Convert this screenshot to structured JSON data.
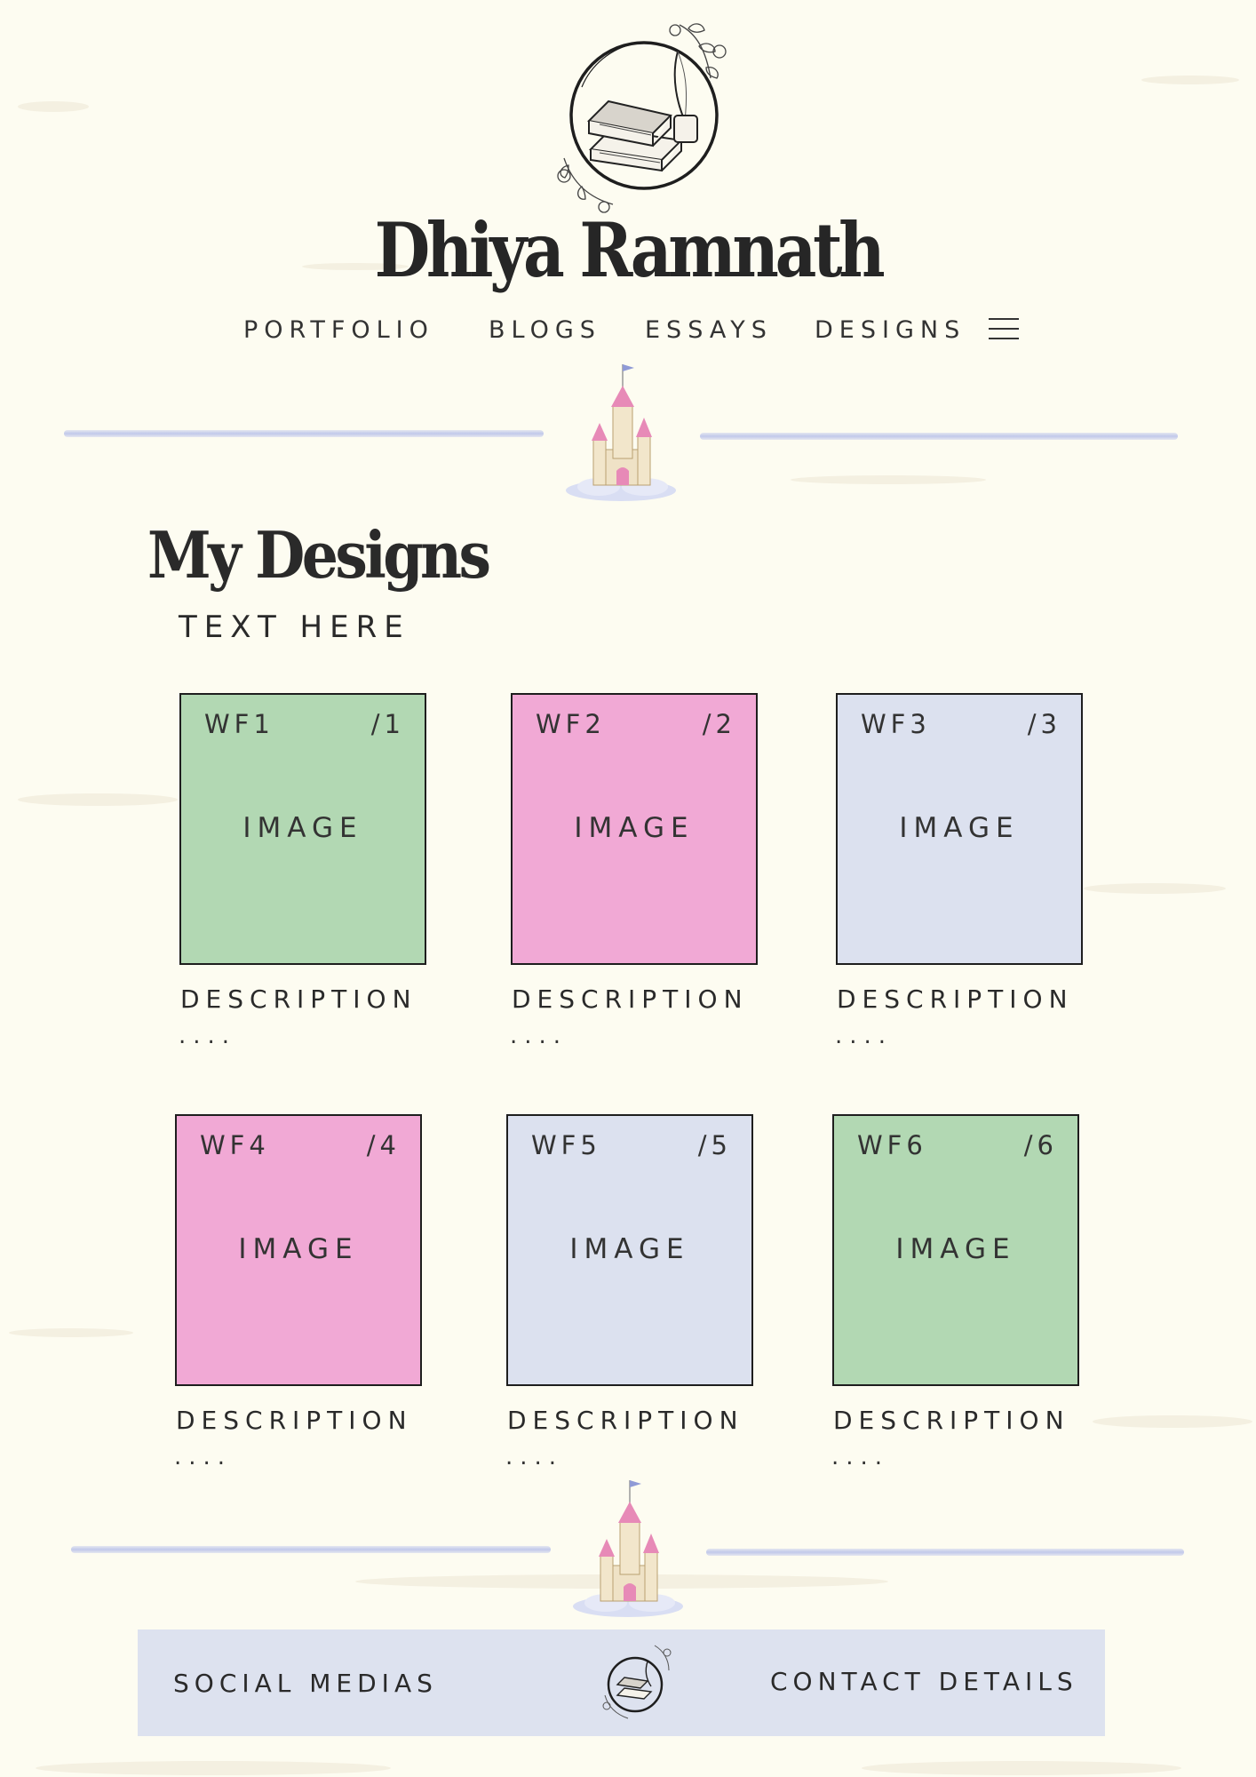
{
  "header": {
    "site_title": "Dhiya Ramnath",
    "logo_icon": "books-quill-ink-wreath-icon"
  },
  "nav": {
    "items": [
      {
        "label": "PORTFOLIO"
      },
      {
        "label": "BLOGS"
      },
      {
        "label": "ESSAYS"
      },
      {
        "label": "DESIGNS"
      }
    ],
    "menu_icon": "hamburger-menu-icon"
  },
  "main": {
    "heading": "My Designs",
    "subtitle": "TEXT HERE",
    "cards": [
      {
        "code": "WF1",
        "number": "/1",
        "image_label": "IMAGE",
        "description": "DESCRIPTION",
        "more": "....",
        "color": "#b2d8b3"
      },
      {
        "code": "WF2",
        "number": "/2",
        "image_label": "IMAGE",
        "description": "DESCRIPTION",
        "more": "....",
        "color": "#f1a9d5"
      },
      {
        "code": "WF3",
        "number": "/3",
        "image_label": "IMAGE",
        "description": "DESCRIPTION",
        "more": "....",
        "color": "#dce1ef"
      },
      {
        "code": "WF4",
        "number": "/4",
        "image_label": "IMAGE",
        "description": "DESCRIPTION",
        "more": "....",
        "color": "#f1a9d5"
      },
      {
        "code": "WF5",
        "number": "/5",
        "image_label": "IMAGE",
        "description": "DESCRIPTION",
        "more": "....",
        "color": "#dce1ef"
      },
      {
        "code": "WF6",
        "number": "/6",
        "image_label": "IMAGE",
        "description": "DESCRIPTION",
        "more": "....",
        "color": "#b2d8b3"
      }
    ]
  },
  "footer": {
    "social_label": "SOCIAL MEDIAS",
    "contact_label": "CONTACT DETAILS",
    "background": "#dde2ef"
  },
  "colors": {
    "page_background": "#fdfcf1",
    "divider": "#c7cdec",
    "text": "#2a2a2a"
  }
}
